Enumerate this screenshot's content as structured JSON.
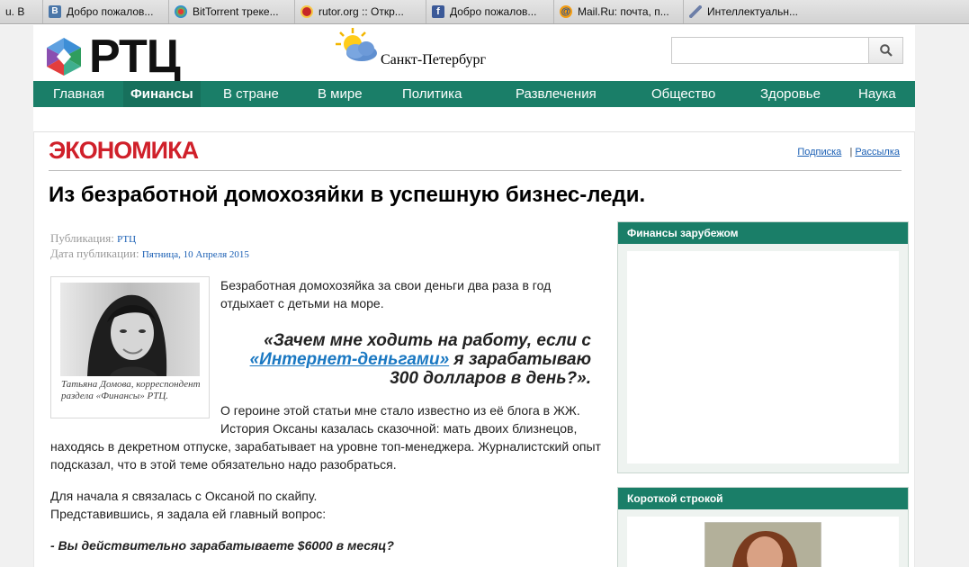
{
  "bookmarks": [
    {
      "label": "u. В",
      "icon": "blank-icon",
      "color": "#e4e4e4"
    },
    {
      "label": "Добро пожалов...",
      "icon": "vk-icon",
      "color": "#4a76a8"
    },
    {
      "label": "BitTorrent треке...",
      "icon": "bittorrent-icon",
      "color": "#7cb342"
    },
    {
      "label": "rutor.org :: Откр...",
      "icon": "rutor-icon",
      "color": "#c62828"
    },
    {
      "label": "Добро пожалов...",
      "icon": "facebook-icon",
      "color": "#3b5998"
    },
    {
      "label": "Mail.Ru: почта, п...",
      "icon": "mailru-icon",
      "color": "#f39c12"
    },
    {
      "label": "Интеллектуальн...",
      "icon": "pen-icon",
      "color": "#6d7fa8"
    }
  ],
  "header": {
    "logo_text": "РТЦ",
    "city": "Санкт-Петербург",
    "search": {
      "placeholder": "",
      "value": ""
    }
  },
  "nav": [
    {
      "label": "Главная",
      "active": false
    },
    {
      "label": "Финансы",
      "active": true
    },
    {
      "label": "В стране",
      "active": false
    },
    {
      "label": "В мире",
      "active": false
    },
    {
      "label": "Политика",
      "active": false
    },
    {
      "label": "Развлечения",
      "active": false
    },
    {
      "label": "Общество",
      "active": false
    },
    {
      "label": "Здоровье",
      "active": false
    },
    {
      "label": "Наука",
      "active": false
    }
  ],
  "section": {
    "title": "ЭКОНОМИКА",
    "subscribe": "Подписка",
    "separator": "|",
    "mailing": "Рассылка"
  },
  "article": {
    "headline": "Из безработной домохозяйки в успешную бизнес-леди.",
    "publication_label": "Публикация:",
    "publication_value": "РТЦ",
    "date_label": "Дата публикации:",
    "date_value": "Пятница, 10 Апреля 2015",
    "caption": "Татьяна Домова, корреспондент раздела «Финансы» РТЦ.",
    "intro": "Безработная домохозяйка за свои деньги два раза в год отдыхает с детьми на море.",
    "quote_before": "«Зачем мне ходить на работу, если с",
    "quote_link": "«Интернет-деньгами»",
    "quote_after": " я зарабатываю 300 долларов в день?».",
    "para1": "О героине этой статьи мне стало известно из её блога в ЖЖ. История Оксаны казалась сказочной: мать двоих близнецов,",
    "para1b": "находясь в декретном отпуске, зарабатывает на уровне топ-менеджера. Журналистский опыт подсказал, что в этой теме обязательно надо разобраться.",
    "para2a": "Для начала я связалась с Оксаной по скайпу.",
    "para2b": "Представившись, я задала ей главный вопрос:",
    "question": "- Вы действительно зарабатываете $6000 в месяц?"
  },
  "widgets": {
    "abroad_title": "Финансы зарубежом",
    "short_title": "Короткой строкой"
  },
  "colors": {
    "nav_green": "#1a7e68",
    "section_red": "#d0202a",
    "link_blue": "#1a5fb4"
  }
}
